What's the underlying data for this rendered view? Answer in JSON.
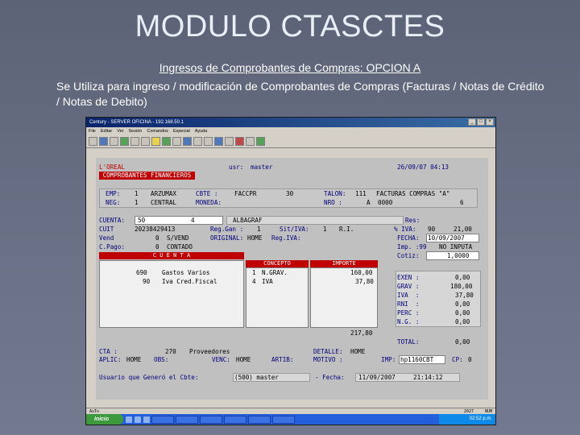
{
  "slide": {
    "title": "MODULO CTASCTES",
    "subtitle": "Ingresos de Comprobantes de Compras: OPCION A",
    "description": "Se Utiliza para ingreso / modificación de Comprobantes de Compras (Facturas / Notas de Crédito / Notas de Debito)"
  },
  "window": {
    "title": "Century - SERVER OFICINA - 192.168.50.1",
    "menu": [
      "File",
      "Editar",
      "Ver",
      "Sesión",
      "Comandos",
      "Especial",
      "Ayuda"
    ]
  },
  "terminal": {
    "company": "L'OREAL",
    "user_label": "usr:",
    "user": "master",
    "datetime": "26/09/07 04:13",
    "section": " COMPROBANTES FINANCIEROS ",
    "emp_label": "EMP:",
    "emp_code": "1",
    "emp_name": "ARZUMAX",
    "neg_label": "NEG:",
    "neg_code": "1",
    "neg_name": "CENTRAL",
    "cbte_label": "CBTE :",
    "cbte_value": "FACCPR",
    "cbte_num": "30",
    "moneda_label": "MONEDA:",
    "talon_label": "TALON:",
    "talon_num": "111",
    "talon_name": "FACTURAS COMPRAS \"A\"",
    "nro_label": "NRO :",
    "nro_letter": "A",
    "nro_value": "0000",
    "nro_extra": "6",
    "cuenta_label": "CUENTA:",
    "cuenta_num": "50",
    "cuenta_sub": "4",
    "cuenta_name": "ALBAGRAF",
    "res_label": "Res:",
    "cuit_label": "CUIT",
    "cuit_value": "20238429413",
    "reg_gan_label": "Reg.Gan :",
    "reg_gan_value": "1",
    "sit_iva_label": "Sit/IVA:",
    "sit_iva_value": "1",
    "sit_iva_name": "R.I.",
    "pct_iva_label": "% IVA:",
    "pct_iva_value": "90",
    "pct_iva_rate": "21,00",
    "vend_label": "Vend",
    "vend_value": "0",
    "vend_name": "S/VEND",
    "original_label": "ORIGINAL:",
    "original_value": "HOME",
    "reg_iva_label": "Reg.IVA:",
    "fecha_label": "FECHA:",
    "fecha_value": "10/09/2007",
    "cpago_label": "C.Pago:",
    "cpago_value": "0",
    "cpago_name": "CONTADO",
    "imp_label": "Imp. :99",
    "imp_value": "NO INPUTA",
    "cotiz_label": "Cotiz:",
    "cotiz_value": "1,0000",
    "grid_headers": [
      "C U E N T A",
      "CONCEPTO",
      "IMPORTE"
    ],
    "grid_rows": [
      {
        "cta": "690",
        "nombre": "Gastos Varios",
        "con": "1",
        "concepto": "N.GRAV.",
        "importe": "160,00"
      },
      {
        "cta": "90",
        "nombre": "Iva Cred.Fiscal",
        "con": "4",
        "concepto": "IVA",
        "importe": "37,80"
      }
    ],
    "grid_total": "217,80",
    "totals": [
      {
        "label": "EXEN :",
        "value": "0,00"
      },
      {
        "label": "GRAV :",
        "value": "180,00"
      },
      {
        "label": "IVA  :",
        "value": "37,80"
      },
      {
        "label": "RNI  :",
        "value": "0,00"
      },
      {
        "label": "PERC :",
        "value": "0,00"
      },
      {
        "label": "N.G. :",
        "value": "0,00"
      }
    ],
    "total_label": "TOTAL:",
    "total_value": "0,00",
    "cta_label": "CTA :",
    "cta_value": "270",
    "cta_name": "Proveedores",
    "aplic_label": "APLIC:",
    "aplic_value": "HOME",
    "obs_label": "OBS:",
    "venc_label": "VENC:",
    "venc_value": "HOME",
    "artib_label": "ARTIB:",
    "detalle_label": "DETALLE:",
    "detalle_value": "HOME",
    "motivo_label": "MOTIVO :",
    "imp2_label": "IMP:",
    "imp2_value": "hp1160CBT",
    "cp_label": "CP:",
    "cp_value": "0",
    "footer_user_label": "Usuario que Generó el Cbte:",
    "footer_user": "(500) master",
    "footer_fecha_label": "- Fecha:",
    "footer_fecha": "11/09/2007",
    "footer_time": "21:14:12"
  },
  "statusbar": {
    "left": "AuTo",
    "mid": "2027",
    "right": "NUM"
  },
  "taskbar": {
    "start": "Inicio",
    "clock": "02:52 p.m."
  }
}
